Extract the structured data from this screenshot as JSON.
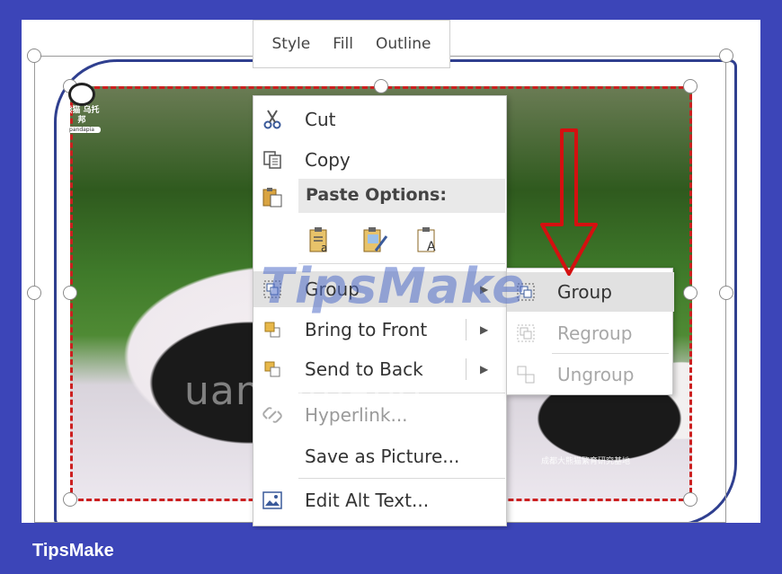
{
  "mini_toolbar": {
    "style": "Style",
    "fill": "Fill",
    "outline": "Outline"
  },
  "context_menu": {
    "cut": "Cut",
    "copy": "Copy",
    "paste_options": "Paste Options:",
    "group": "Group",
    "bring_to_front": "Bring to Front",
    "send_to_back": "Send to Back",
    "hyperlink": "Hyperlink...",
    "save_as_picture": "Save as Picture...",
    "edit_alt_text": "Edit Alt Text..."
  },
  "submenu": {
    "group": "Group",
    "regroup": "Regroup",
    "ungroup": "Ungroup"
  },
  "image": {
    "logo_text": "熊猫 乌托邦",
    "logo_pill": "pandapia",
    "caption": "成都大熊猫繁育研究基地"
  },
  "watermarks": {
    "tipsmake": "TipsMake",
    "quantrimang": "uantrimang"
  },
  "footer": {
    "brand": "TipsMake"
  },
  "colors": {
    "frame": "#3c45b8",
    "selection_dash": "#cc2020",
    "arrow": "#d41010"
  }
}
